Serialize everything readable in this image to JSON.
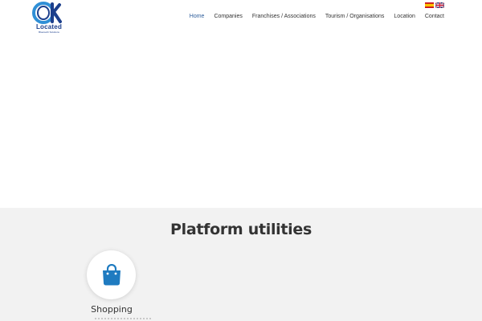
{
  "logo": {
    "mark": "OK",
    "name": "Located",
    "tagline": "Bluetooth Solutions"
  },
  "languages": [
    {
      "icon": "spanish-flag-icon"
    },
    {
      "icon": "english-flag-icon"
    }
  ],
  "nav": {
    "items": [
      {
        "label": "Home",
        "active": true
      },
      {
        "label": "Companies",
        "active": false
      },
      {
        "label": "Franchises / Associations",
        "active": false
      },
      {
        "label": "Tourism / Organisations",
        "active": false
      },
      {
        "label": "Location",
        "active": false
      },
      {
        "label": "Contact",
        "active": false
      }
    ]
  },
  "utilities": {
    "title": "Platform utilities",
    "items": [
      {
        "label": "Shopping",
        "icon": "shopping-bag-icon"
      }
    ]
  },
  "colors": {
    "nav_active": "#2d5d9b",
    "logo_blue": "#1c3f8c",
    "logo_accent": "#2f8fd6",
    "section_bg": "#f2f2f2",
    "icon_blue": "#1f7bc0"
  }
}
